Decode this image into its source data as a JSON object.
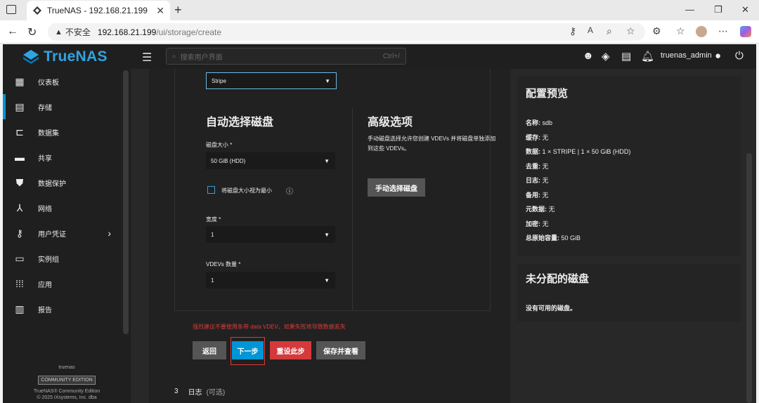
{
  "browser": {
    "tab_title": "TrueNAS - 192.168.21.199",
    "security_label": "不安全",
    "url_host": "192.168.21.199",
    "url_path": "/ui/storage/create"
  },
  "app": {
    "brand": "TrueNAS",
    "search_placeholder": "搜索用户界面",
    "search_shortcut": "Ctrl+/",
    "username": "truenas_admin"
  },
  "sidebar": {
    "items": [
      {
        "label": "仪表板",
        "icon": "dashboard-icon"
      },
      {
        "label": "存储",
        "icon": "storage-icon"
      },
      {
        "label": "数据集",
        "icon": "datasets-icon"
      },
      {
        "label": "共享",
        "icon": "shares-icon"
      },
      {
        "label": "数据保护",
        "icon": "shield-icon"
      },
      {
        "label": "网络",
        "icon": "network-icon"
      },
      {
        "label": "用户凭证",
        "icon": "key-icon"
      },
      {
        "label": "实例组",
        "icon": "instances-icon"
      },
      {
        "label": "应用",
        "icon": "apps-icon"
      },
      {
        "label": "报告",
        "icon": "reports-icon"
      }
    ],
    "footer_host": "truenas",
    "edition": "COMMUNITY EDITION",
    "footer_product": "TrueNAS® Community Edition",
    "footer_copyright": "© 2025 iXsystems, Inc. dba"
  },
  "form": {
    "layout_value": "Stripe",
    "auto_heading": "自动选择磁盘",
    "disk_size_label": "磁盘大小 *",
    "disk_size_value": "50 GiB (HDD)",
    "treat_min_label": "将磁盘大小视为最小",
    "width_label": "宽度 *",
    "width_value": "1",
    "vdevs_label": "VDEVs 数量 *",
    "vdevs_value": "1",
    "advanced_heading": "高级选项",
    "advanced_desc": "手动磁盘选择允许您创建 VDEVs 并将磁盘单独添加到这些 VDEVs。",
    "manual_button": "手动选择磁盘",
    "warning": "强烈建议不要使用条带 data VDEV，如果失败将导致数据丢失",
    "back_button": "返回",
    "next_button": "下一步",
    "reset_button": "重设此步",
    "save_review_button": "保存并查看",
    "step3_number": "3",
    "step3_label": "日志",
    "step3_optional": "(可选)"
  },
  "preview": {
    "title": "配置预览",
    "rows": [
      {
        "k": "名称:",
        "v": "sdb"
      },
      {
        "k": "缓存:",
        "v": "无"
      },
      {
        "k": "数据:",
        "v": "1 × STRIPE | 1 × 50 GiB (HDD)"
      },
      {
        "k": "去重:",
        "v": "无"
      },
      {
        "k": "日志:",
        "v": "无"
      },
      {
        "k": "备用:",
        "v": "无"
      },
      {
        "k": "元数据:",
        "v": "无"
      },
      {
        "k": "加密:",
        "v": "无"
      },
      {
        "k": "总原始容量:",
        "v": "50 GiB"
      }
    ]
  },
  "unassigned": {
    "title": "未分配的磁盘",
    "text": "没有可用的磁盘。"
  },
  "colors": {
    "accent": "#0095d5",
    "danger": "#e03a3a",
    "brand": "#2fa4e0"
  }
}
